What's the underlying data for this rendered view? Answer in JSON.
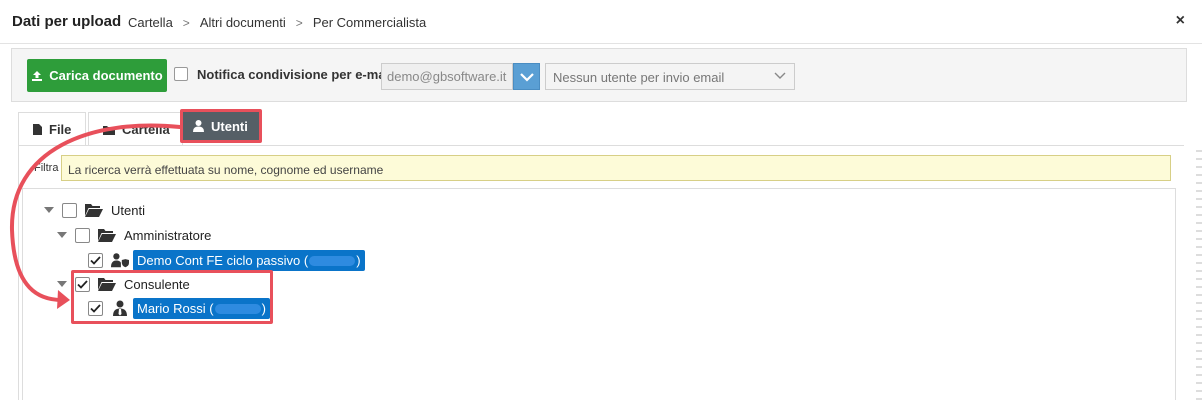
{
  "header": {
    "title": "Dati per upload",
    "breadcrumbs": [
      "Cartella",
      "Altri documenti",
      "Per Commercialista"
    ],
    "close_label": "×"
  },
  "toolbar": {
    "upload_label": "Carica documento",
    "notify_label": "Notifica condivisione per e-mail",
    "notify_checked": false,
    "email_value": "demo@gbsoftware.it",
    "user_select_value": "Nessun utente per invio email"
  },
  "tabs": [
    {
      "label": "File",
      "icon": "file-icon"
    },
    {
      "label": "Cartella",
      "icon": "folder-icon"
    },
    {
      "label": "Utenti",
      "icon": "user-icon",
      "active": true
    }
  ],
  "filter": {
    "label": "Filtra",
    "placeholder": "La ricerca verrà effettuata su nome, cognome ed username"
  },
  "tree": {
    "root": {
      "label": "Utenti",
      "checked": false
    },
    "groups": [
      {
        "label": "Amministratore",
        "checked": false,
        "users": [
          {
            "label": "Demo Cont FE ciclo passivo (",
            "suffix": ")",
            "checked": true
          }
        ]
      },
      {
        "label": "Consulente",
        "checked": true,
        "users": [
          {
            "label": "Mario Rossi (",
            "suffix": ")",
            "checked": true
          }
        ]
      }
    ]
  },
  "colors": {
    "accent_green": "#2e9d3a",
    "selection_blue": "#0a74c9",
    "highlight_red": "#e8505b",
    "active_tab": "#555f66"
  }
}
